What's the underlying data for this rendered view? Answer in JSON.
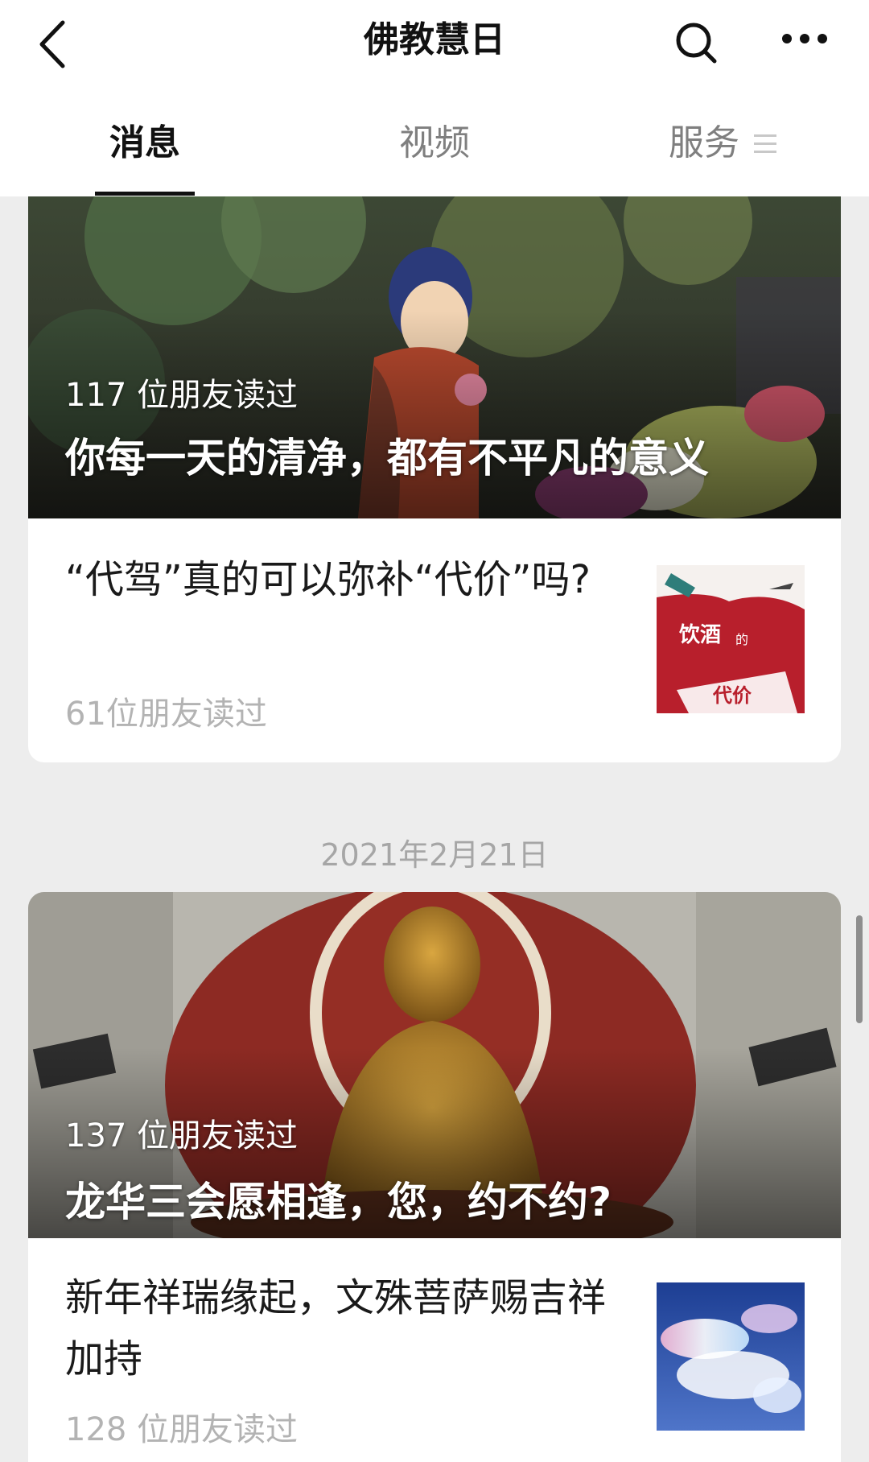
{
  "header": {
    "title": "佛教慧日",
    "back_icon": "chevron-left-icon",
    "search_icon": "search-icon",
    "more_icon": "more-dots-icon"
  },
  "tabs": [
    {
      "label": "消息",
      "active": true
    },
    {
      "label": "视频",
      "active": false
    },
    {
      "label": "服务",
      "active": false,
      "icon": "menu-lines-icon"
    }
  ],
  "feed": {
    "card1": {
      "hero_reads": "117 位朋友读过",
      "hero_title": "你每一天的清净，都有不平凡的意义",
      "article_title": "“代驾”真的可以弥补“代价”吗?",
      "article_reads": "61位朋友读过",
      "thumb_text_1": "饮酒",
      "thumb_text_2": "的",
      "thumb_text_3": "代价"
    },
    "date": "2021年2月21日",
    "card2": {
      "hero_reads": "137 位朋友读过",
      "hero_title": "龙华三会愿相逢，您，约不约?",
      "article_title": "新年祥瑞缘起，文殊菩萨赐吉祥加持",
      "article_reads": "128 位朋友读过"
    }
  },
  "colors": {
    "background": "#ededed",
    "card": "#ffffff",
    "muted_text": "#b3b3b3",
    "date_text": "#a6a6a6"
  }
}
